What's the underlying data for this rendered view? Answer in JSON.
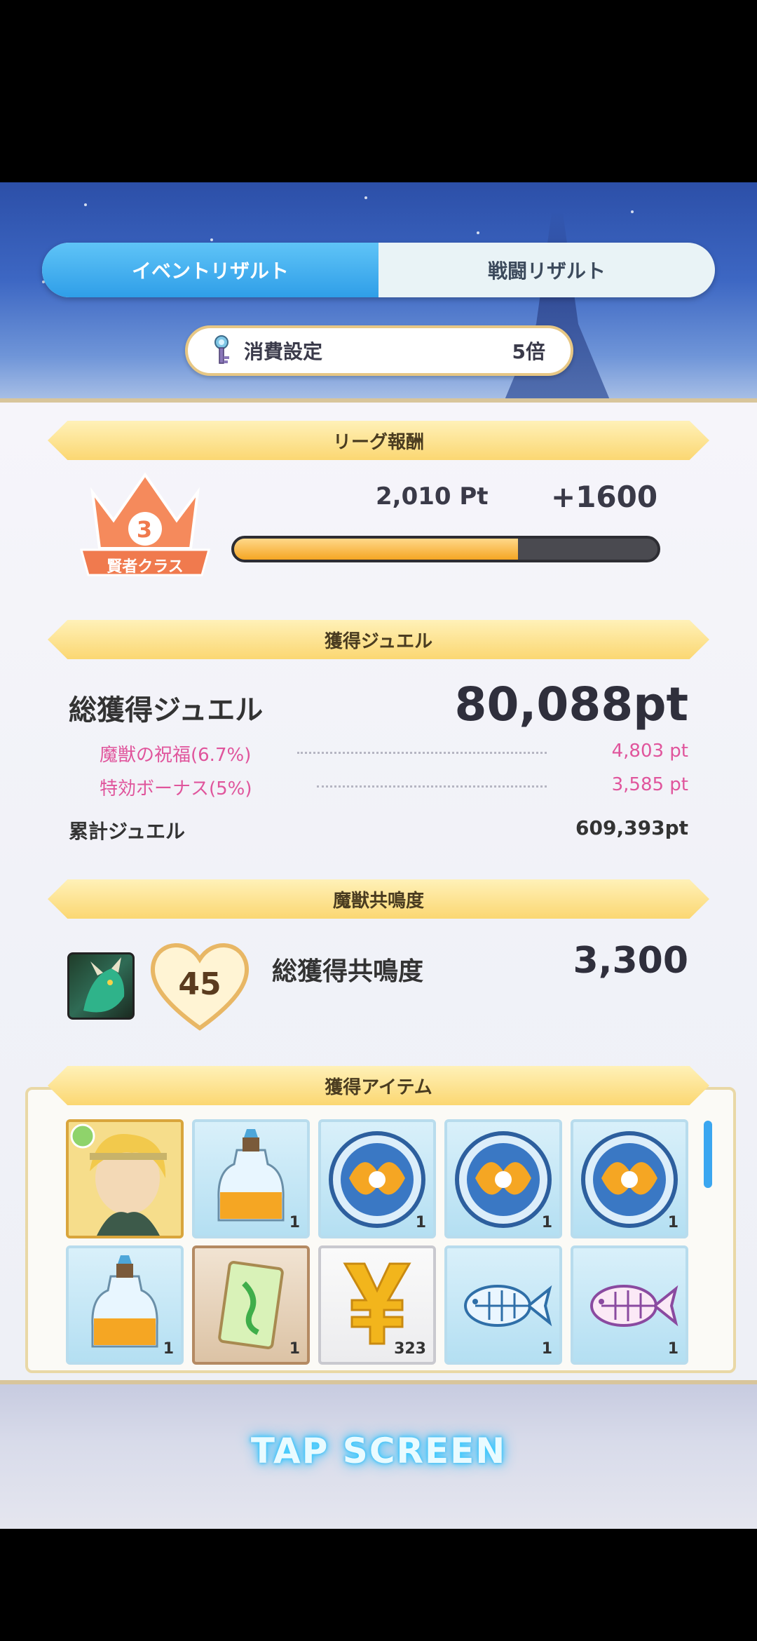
{
  "tabs": {
    "event_result": "イベントリザルト",
    "battle_result": "戦闘リザルト"
  },
  "consume_setting": {
    "label": "消費設定",
    "value": "5倍"
  },
  "league": {
    "title": "リーグ報酬",
    "rank_number": "3",
    "rank_class": "賢者クラス",
    "points": "2,010 Pt",
    "gain": "+1600",
    "progress_fraction": 0.67
  },
  "jewel": {
    "title": "獲得ジュエル",
    "total_label": "総獲得ジュエル",
    "total_value": "80,088pt",
    "bonus1_label": "魔獣の祝福(6.7%)",
    "bonus1_value": "4,803 pt",
    "bonus2_label": "特効ボーナス(5%)",
    "bonus2_value": "3,585 pt",
    "cumulative_label": "累計ジュエル",
    "cumulative_value": "609,393pt"
  },
  "resonance": {
    "title": "魔獣共鳴度",
    "level": "45",
    "total_label": "総獲得共鳴度",
    "total_value": "3,300"
  },
  "items": {
    "title": "獲得アイテム",
    "row1": [
      {
        "icon": "character-card-icon",
        "count": ""
      },
      {
        "icon": "potion-bottle-icon",
        "count": "1"
      },
      {
        "icon": "emblem-orb-icon",
        "count": "1"
      },
      {
        "icon": "emblem-orb-icon",
        "count": "1"
      },
      {
        "icon": "emblem-orb-icon",
        "count": "1"
      }
    ],
    "row2": [
      {
        "icon": "potion-bottle-icon",
        "count": "1"
      },
      {
        "icon": "green-card-icon",
        "count": "1"
      },
      {
        "icon": "gold-yen-icon",
        "count": "323"
      },
      {
        "icon": "fish-bone-blue-icon",
        "count": "1"
      },
      {
        "icon": "fish-bone-pink-icon",
        "count": "1"
      }
    ]
  },
  "tap_screen": "TAP SCREEN",
  "colors": {
    "accent_blue": "#2f9ee8",
    "bonus_pink": "#e0559c",
    "ribbon_gold": "#fbd772",
    "progress_orange": "#f5a623"
  }
}
